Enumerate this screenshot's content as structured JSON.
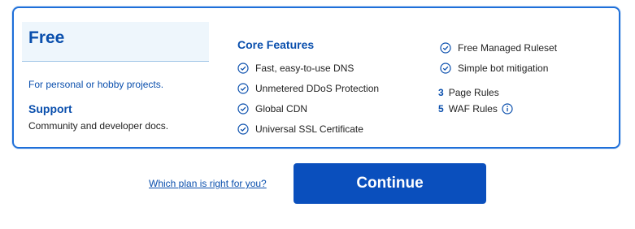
{
  "plan": {
    "name": "Free",
    "description": "For personal or hobby projects.",
    "support_title": "Support",
    "support_desc": "Community and developer docs."
  },
  "features": {
    "title": "Core Features",
    "items": [
      "Fast, easy-to-use DNS",
      "Unmetered DDoS Protection",
      "Global CDN",
      "Universal SSL Certificate"
    ],
    "extra": [
      "Free Managed Ruleset",
      "Simple bot mitigation"
    ]
  },
  "rules": [
    {
      "count": "3",
      "label": "Page Rules"
    },
    {
      "count": "5",
      "label": "WAF Rules"
    }
  ],
  "footer": {
    "help_link": "Which plan is right for you?",
    "continue_label": "Continue"
  },
  "colors": {
    "accent": "#0a4fad",
    "border": "#1e6fd9",
    "button": "#0a4fbd"
  }
}
